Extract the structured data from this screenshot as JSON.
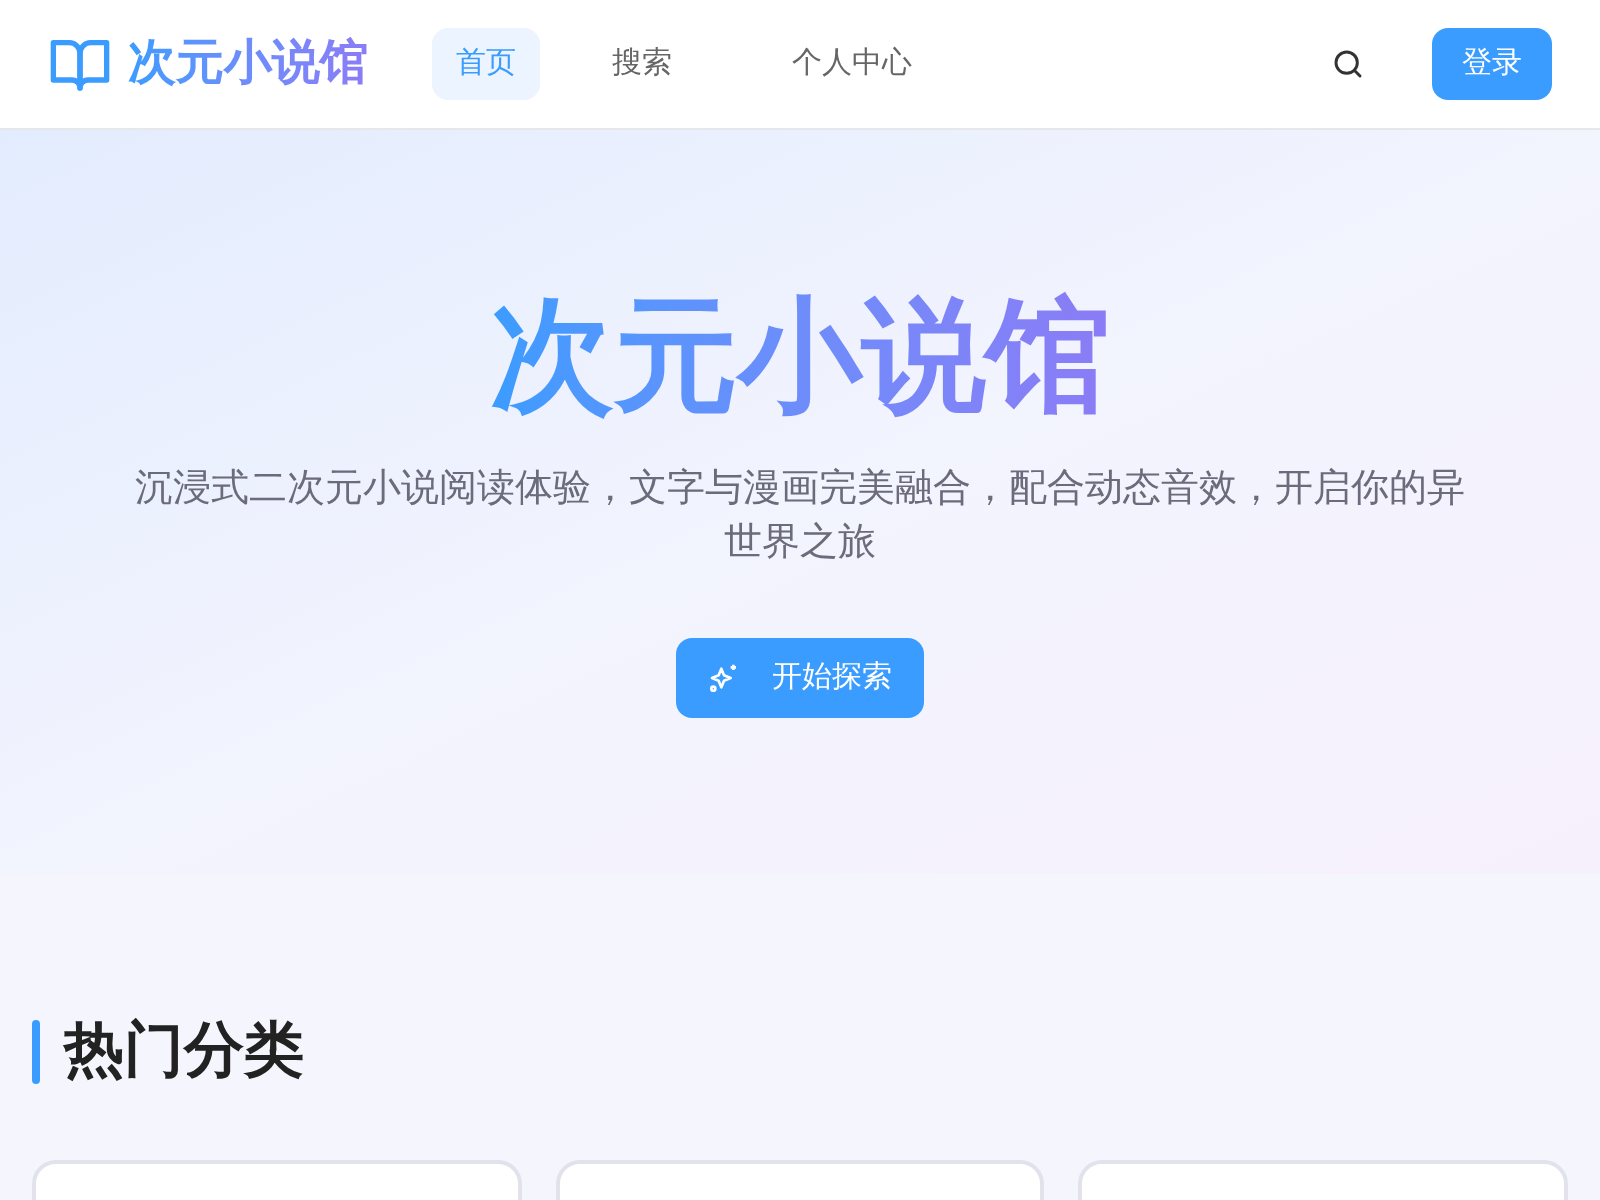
{
  "header": {
    "logo": "次元小说馆",
    "nav": [
      {
        "label": "首页",
        "selected": true
      },
      {
        "label": "搜索",
        "selected": false
      },
      {
        "label": "个人中心",
        "selected": false
      }
    ],
    "login": "登录"
  },
  "hero": {
    "title": "次元小说馆",
    "subtitle": "沉浸式二次元小说阅读体验，文字与漫画完美融合，配合动态音效，开启你的异世界之旅",
    "cta": "开始探索"
  },
  "section": {
    "title": "热门分类",
    "cards": [
      {
        "kind": "card"
      },
      {
        "kind": "card"
      },
      {
        "kind": "card"
      }
    ]
  }
}
